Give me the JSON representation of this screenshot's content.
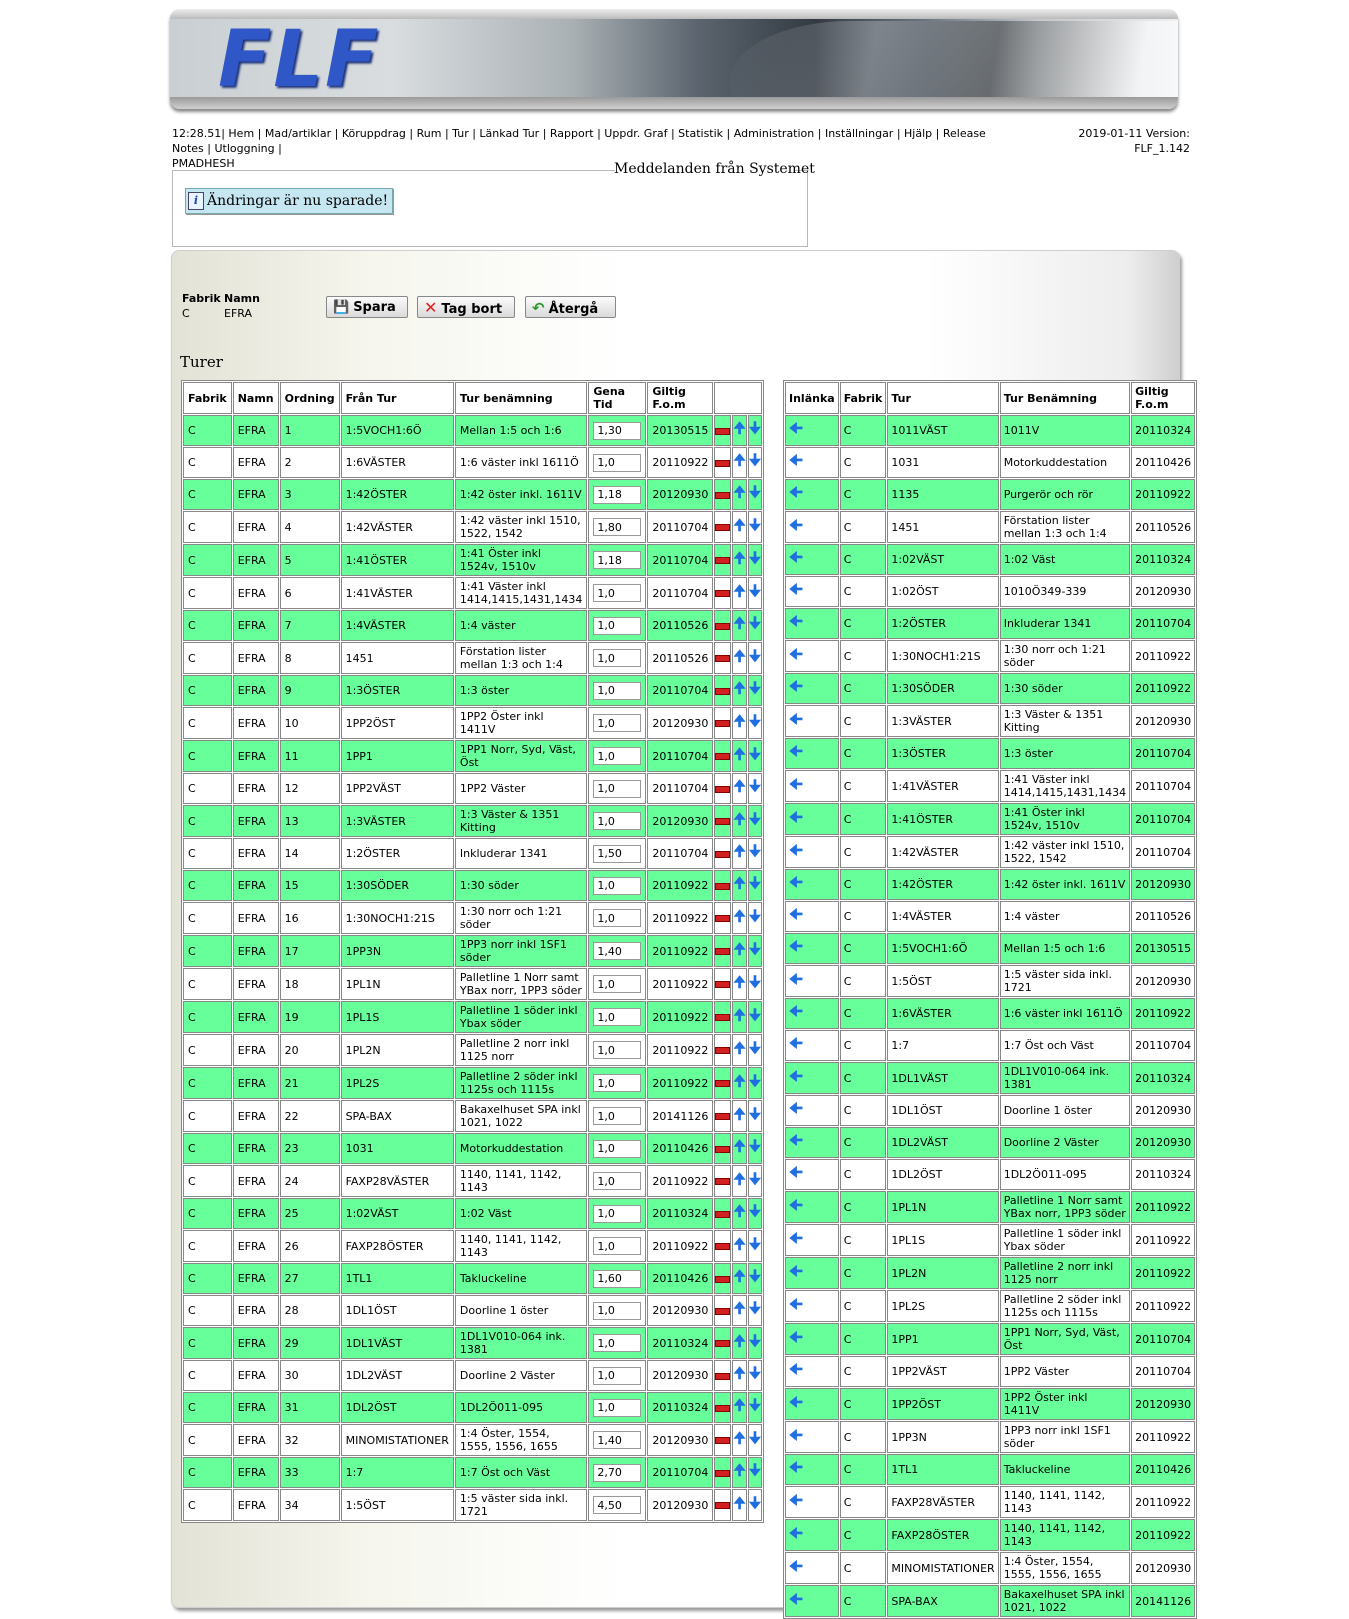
{
  "logo_text": "FLF",
  "nav": {
    "time": "12:28.51|",
    "items": [
      "Hem",
      "Mad/artiklar",
      "Köruppdrag",
      "Rum",
      "Tur",
      "Länkad Tur",
      "Rapport",
      "Uppdr. Graf",
      "Statistik",
      "Administration",
      "Inställningar",
      "Hjälp",
      "Release Notes",
      "Utloggning"
    ],
    "user": "PMADHESH",
    "version_line1": "2019-01-11 Version:",
    "version_line2": "FLF_1.142"
  },
  "messages": {
    "legend": "Meddelanden från Systemet",
    "info_icon": "i",
    "text": "Ändringar är nu sparade!"
  },
  "header": {
    "fabrik_label": "Fabrik",
    "namn_label": "Namn",
    "fabrik_value": "C",
    "namn_value": "EFRA"
  },
  "buttons": {
    "spara": "Spara",
    "tag_bort": "Tag bort",
    "atergaa": "Återgå"
  },
  "section_title": "Turer",
  "left_table": {
    "columns": [
      "Fabrik",
      "Namn",
      "Ordning",
      "Från Tur",
      "Tur benämning",
      "Gena Tid",
      "Giltig F.o.m"
    ],
    "rows": [
      [
        "C",
        "EFRA",
        "1",
        "1:5VOCH1:6Ö",
        "Mellan 1:5 och 1:6",
        "1,30",
        "20130515"
      ],
      [
        "C",
        "EFRA",
        "2",
        "1:6VÄSTER",
        "1:6 väster inkl 1611Ö",
        "1,0",
        "20110922"
      ],
      [
        "C",
        "EFRA",
        "3",
        "1:42ÖSTER",
        "1:42 öster inkl. 1611V",
        "1,18",
        "20120930"
      ],
      [
        "C",
        "EFRA",
        "4",
        "1:42VÄSTER",
        "1:42 väster inkl 1510, 1522, 1542",
        "1,80",
        "20110704"
      ],
      [
        "C",
        "EFRA",
        "5",
        "1:41ÖSTER",
        "1:41 Öster inkl 1524v, 1510v",
        "1,18",
        "20110704"
      ],
      [
        "C",
        "EFRA",
        "6",
        "1:41VÄSTER",
        "1:41 Väster inkl 1414,1415,1431,1434",
        "1,0",
        "20110704"
      ],
      [
        "C",
        "EFRA",
        "7",
        "1:4VÄSTER",
        "1:4 väster",
        "1,0",
        "20110526"
      ],
      [
        "C",
        "EFRA",
        "8",
        "1451",
        "Förstation lister mellan 1:3 och 1:4",
        "1,0",
        "20110526"
      ],
      [
        "C",
        "EFRA",
        "9",
        "1:3ÖSTER",
        "1:3 öster",
        "1,0",
        "20110704"
      ],
      [
        "C",
        "EFRA",
        "10",
        "1PP2ÖST",
        "1PP2 Öster inkl 1411V",
        "1,0",
        "20120930"
      ],
      [
        "C",
        "EFRA",
        "11",
        "1PP1",
        "1PP1 Norr, Syd, Väst, Öst",
        "1,0",
        "20110704"
      ],
      [
        "C",
        "EFRA",
        "12",
        "1PP2VÄST",
        "1PP2 Väster",
        "1,0",
        "20110704"
      ],
      [
        "C",
        "EFRA",
        "13",
        "1:3VÄSTER",
        "1:3 Väster & 1351 Kitting",
        "1,0",
        "20120930"
      ],
      [
        "C",
        "EFRA",
        "14",
        "1:2ÖSTER",
        "Inkluderar 1341",
        "1,50",
        "20110704"
      ],
      [
        "C",
        "EFRA",
        "15",
        "1:30SÖDER",
        "1:30 söder",
        "1,0",
        "20110922"
      ],
      [
        "C",
        "EFRA",
        "16",
        "1:30NOCH1:21S",
        "1:30 norr och 1:21 söder",
        "1,0",
        "20110922"
      ],
      [
        "C",
        "EFRA",
        "17",
        "1PP3N",
        "1PP3 norr inkl 1SF1 söder",
        "1,40",
        "20110922"
      ],
      [
        "C",
        "EFRA",
        "18",
        "1PL1N",
        "Palletline 1 Norr samt YBax norr, 1PP3 söder",
        "1,0",
        "20110922"
      ],
      [
        "C",
        "EFRA",
        "19",
        "1PL1S",
        "Palletline 1 söder inkl Ybax söder",
        "1,0",
        "20110922"
      ],
      [
        "C",
        "EFRA",
        "20",
        "1PL2N",
        "Palletline 2 norr inkl 1125 norr",
        "1,0",
        "20110922"
      ],
      [
        "C",
        "EFRA",
        "21",
        "1PL2S",
        "Palletline 2 söder inkl 1125s och 1115s",
        "1,0",
        "20110922"
      ],
      [
        "C",
        "EFRA",
        "22",
        "SPA-BAX",
        "Bakaxelhuset SPA inkl 1021, 1022",
        "1,0",
        "20141126"
      ],
      [
        "C",
        "EFRA",
        "23",
        "1031",
        "Motorkuddestation",
        "1,0",
        "20110426"
      ],
      [
        "C",
        "EFRA",
        "24",
        "FAXP28VÄSTER",
        "1140, 1141, 1142, 1143",
        "1,0",
        "20110922"
      ],
      [
        "C",
        "EFRA",
        "25",
        "1:02VÄST",
        "1:02 Väst",
        "1,0",
        "20110324"
      ],
      [
        "C",
        "EFRA",
        "26",
        "FAXP28ÖSTER",
        "1140, 1141, 1142, 1143",
        "1,0",
        "20110922"
      ],
      [
        "C",
        "EFRA",
        "27",
        "1TL1",
        "Takluckeline",
        "1,60",
        "20110426"
      ],
      [
        "C",
        "EFRA",
        "28",
        "1DL1ÖST",
        "Doorline 1 öster",
        "1,0",
        "20120930"
      ],
      [
        "C",
        "EFRA",
        "29",
        "1DL1VÄST",
        "1DL1V010-064 ink. 1381",
        "1,0",
        "20110324"
      ],
      [
        "C",
        "EFRA",
        "30",
        "1DL2VÄST",
        "Doorline 2 Väster",
        "1,0",
        "20120930"
      ],
      [
        "C",
        "EFRA",
        "31",
        "1DL2ÖST",
        "1DL2Ö011-095",
        "1,0",
        "20110324"
      ],
      [
        "C",
        "EFRA",
        "32",
        "MINOMISTATIONER",
        "1:4 Öster, 1554, 1555, 1556, 1655",
        "1,40",
        "20120930"
      ],
      [
        "C",
        "EFRA",
        "33",
        "1:7",
        "1:7 Öst och Väst",
        "2,70",
        "20110704"
      ],
      [
        "C",
        "EFRA",
        "34",
        "1:5ÖST",
        "1:5 väster sida inkl. 1721",
        "4,50",
        "20120930"
      ]
    ]
  },
  "right_table": {
    "columns": [
      "Inlänka",
      "Fabrik",
      "Tur",
      "Tur Benämning",
      "Giltig F.o.m"
    ],
    "rows": [
      [
        "C",
        "1011VÄST",
        "1011V",
        "20110324"
      ],
      [
        "C",
        "1031",
        "Motorkuddestation",
        "20110426"
      ],
      [
        "C",
        "1135",
        "Purgerör och rör",
        "20110922"
      ],
      [
        "C",
        "1451",
        "Förstation lister mellan 1:3 och 1:4",
        "20110526"
      ],
      [
        "C",
        "1:02VÄST",
        "1:02 Väst",
        "20110324"
      ],
      [
        "C",
        "1:02ÖST",
        "1010Ö349-339",
        "20120930"
      ],
      [
        "C",
        "1:2ÖSTER",
        "Inkluderar 1341",
        "20110704"
      ],
      [
        "C",
        "1:30NOCH1:21S",
        "1:30 norr och 1:21 söder",
        "20110922"
      ],
      [
        "C",
        "1:30SÖDER",
        "1:30 söder",
        "20110922"
      ],
      [
        "C",
        "1:3VÄSTER",
        "1:3 Väster & 1351 Kitting",
        "20120930"
      ],
      [
        "C",
        "1:3ÖSTER",
        "1:3 öster",
        "20110704"
      ],
      [
        "C",
        "1:41VÄSTER",
        "1:41 Väster inkl 1414,1415,1431,1434",
        "20110704"
      ],
      [
        "C",
        "1:41ÖSTER",
        "1:41 Öster inkl 1524v, 1510v",
        "20110704"
      ],
      [
        "C",
        "1:42VÄSTER",
        "1:42 väster inkl 1510, 1522, 1542",
        "20110704"
      ],
      [
        "C",
        "1:42ÖSTER",
        "1:42 öster inkl. 1611V",
        "20120930"
      ],
      [
        "C",
        "1:4VÄSTER",
        "1:4 väster",
        "20110526"
      ],
      [
        "C",
        "1:5VOCH1:6Ö",
        "Mellan 1:5 och 1:6",
        "20130515"
      ],
      [
        "C",
        "1:5ÖST",
        "1:5 väster sida inkl. 1721",
        "20120930"
      ],
      [
        "C",
        "1:6VÄSTER",
        "1:6 väster inkl 1611Ö",
        "20110922"
      ],
      [
        "C",
        "1:7",
        "1:7 Öst och Väst",
        "20110704"
      ],
      [
        "C",
        "1DL1VÄST",
        "1DL1V010-064 ink. 1381",
        "20110324"
      ],
      [
        "C",
        "1DL1ÖST",
        "Doorline 1 öster",
        "20120930"
      ],
      [
        "C",
        "1DL2VÄST",
        "Doorline 2 Väster",
        "20120930"
      ],
      [
        "C",
        "1DL2ÖST",
        "1DL2Ö011-095",
        "20110324"
      ],
      [
        "C",
        "1PL1N",
        "Palletline 1 Norr samt YBax norr, 1PP3 söder",
        "20110922"
      ],
      [
        "C",
        "1PL1S",
        "Palletline 1 söder inkl Ybax söder",
        "20110922"
      ],
      [
        "C",
        "1PL2N",
        "Palletline 2 norr inkl 1125 norr",
        "20110922"
      ],
      [
        "C",
        "1PL2S",
        "Palletline 2 söder inkl 1125s och 1115s",
        "20110922"
      ],
      [
        "C",
        "1PP1",
        "1PP1 Norr, Syd, Väst, Öst",
        "20110704"
      ],
      [
        "C",
        "1PP2VÄST",
        "1PP2 Väster",
        "20110704"
      ],
      [
        "C",
        "1PP2ÖST",
        "1PP2 Öster inkl 1411V",
        "20120930"
      ],
      [
        "C",
        "1PP3N",
        "1PP3 norr inkl 1SF1 söder",
        "20110922"
      ],
      [
        "C",
        "1TL1",
        "Takluckeline",
        "20110426"
      ],
      [
        "C",
        "FAXP28VÄSTER",
        "1140, 1141, 1142, 1143",
        "20110922"
      ],
      [
        "C",
        "FAXP28ÖSTER",
        "1140, 1141, 1142, 1143",
        "20110922"
      ],
      [
        "C",
        "MINOMISTATIONER",
        "1:4 Öster, 1554, 1555, 1556, 1655",
        "20120930"
      ],
      [
        "C",
        "SPA-BAX",
        "Bakaxelhuset SPA inkl 1021, 1022",
        "20141126"
      ]
    ]
  },
  "colors": {
    "row_green": "#66ff99",
    "row_white": "#ffffff",
    "arrow_blue": "#1f6fe0",
    "remove_red": "#d02020"
  },
  "icons": {
    "remove": "minus-icon",
    "move_up": "arrow-up-icon",
    "move_down": "arrow-down-icon",
    "link": "arrow-left-icon",
    "save": "floppy-icon",
    "delete": "x-icon",
    "back": "undo-icon"
  }
}
